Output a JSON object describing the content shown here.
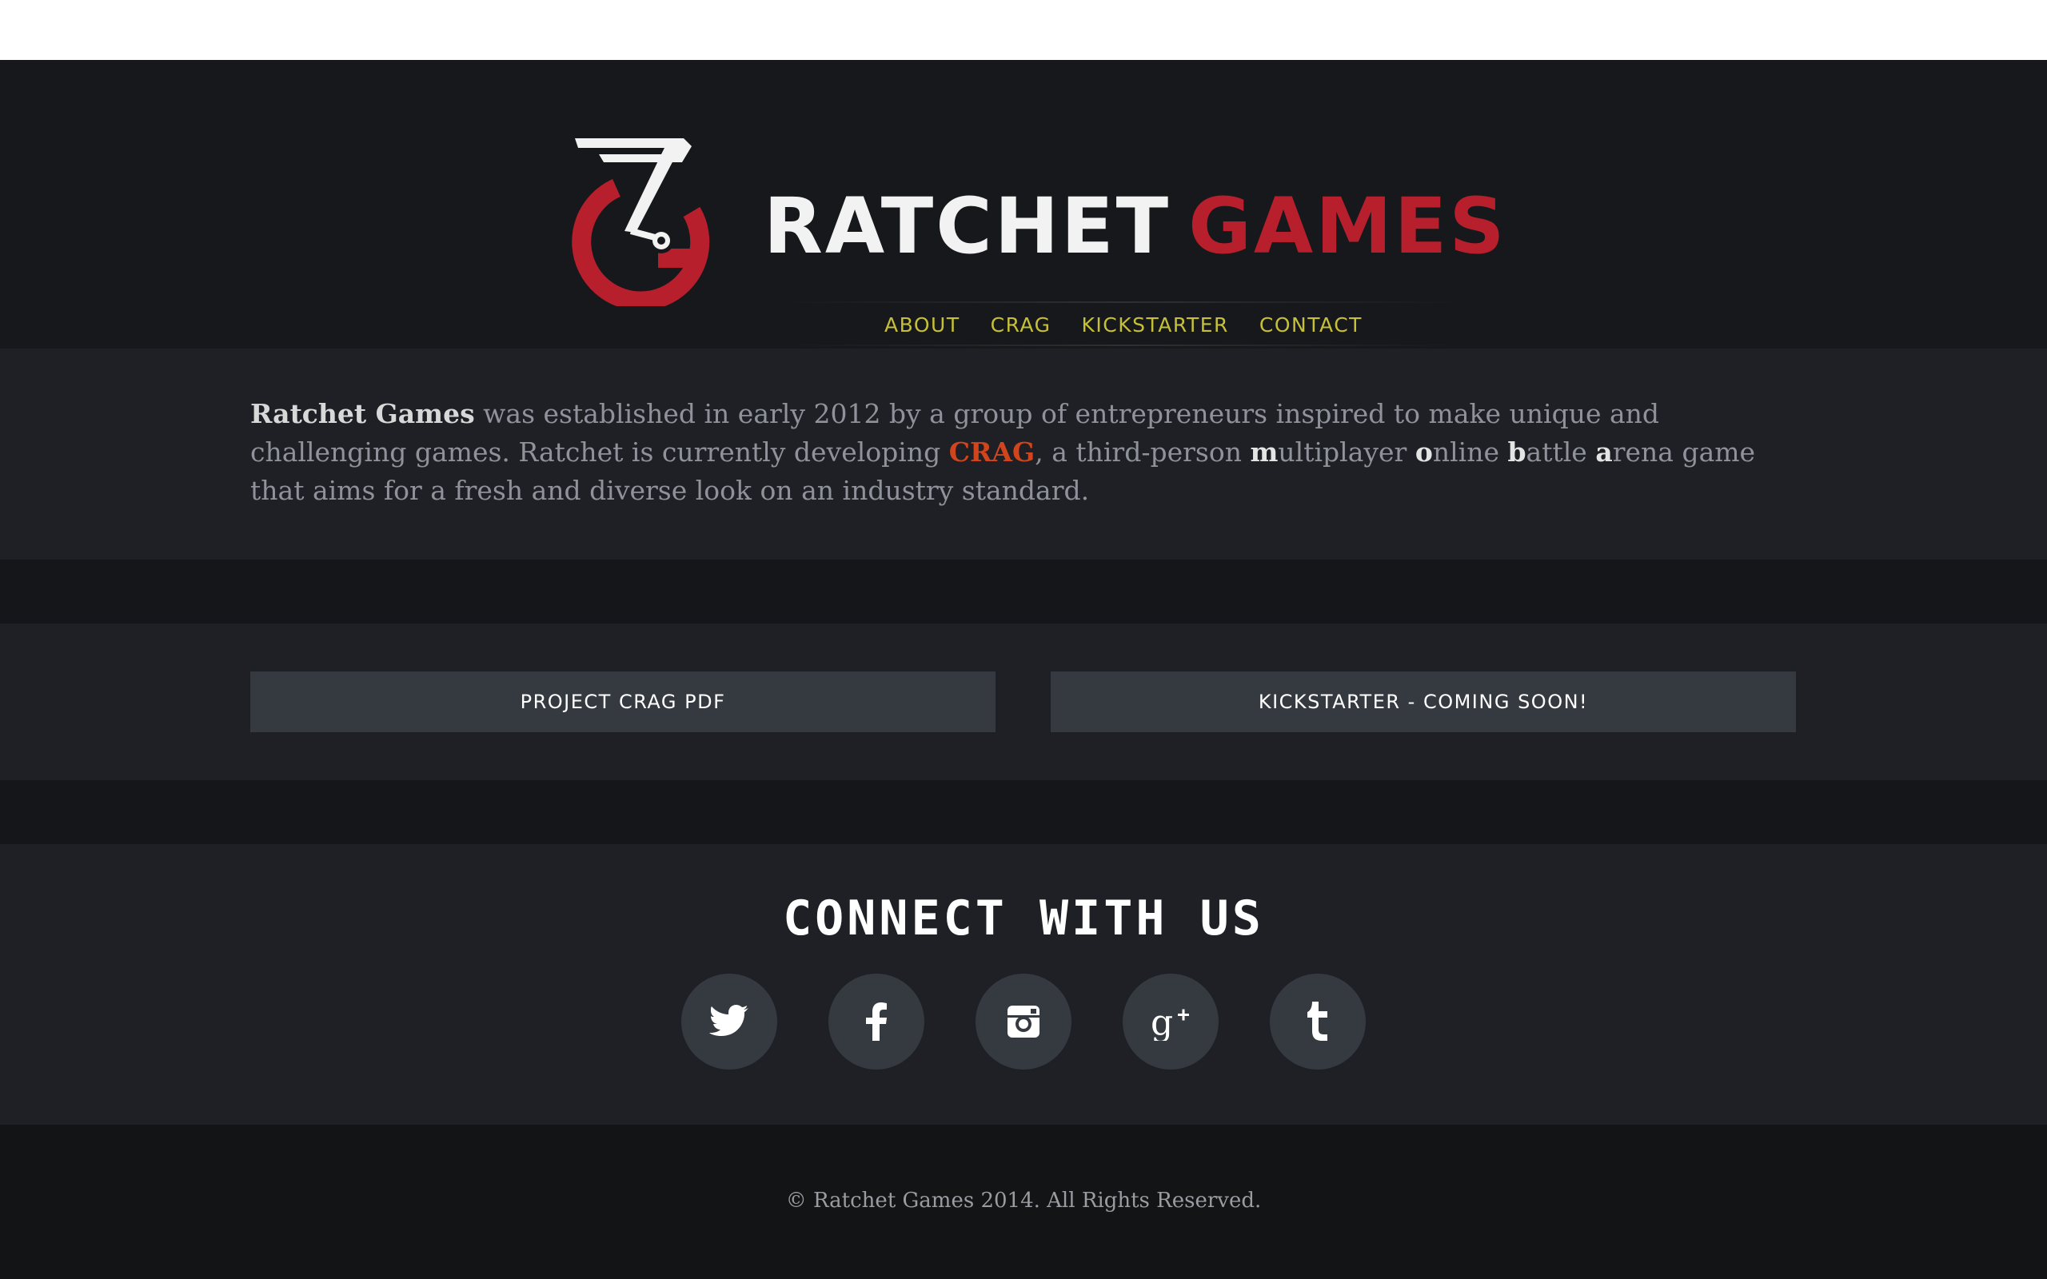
{
  "brand": {
    "name_primary": "RATCHET",
    "name_accent": "GAMES",
    "primary_color": "#f2f2f2",
    "accent_color": "#b81f2d"
  },
  "nav": {
    "items": [
      {
        "label": "ABOUT"
      },
      {
        "label": "CRAG"
      },
      {
        "label": "KICKSTARTER"
      },
      {
        "label": "CONTACT"
      }
    ],
    "color": "#c5c037"
  },
  "about": {
    "company": "Ratchet Games",
    "text_1": " was established in early 2012 by a group of entrepreneurs inspired to make unique and challenging games. Ratchet is currently developing ",
    "project": "CRAG",
    "text_2": ", a third-person ",
    "m": "m",
    "ultiplayer": "ultiplayer ",
    "o": "o",
    "nline": "nline ",
    "b": "b",
    "attle": "attle ",
    "a": "a",
    "rena": "rena game that aims for a fresh and diverse look on an industry standard."
  },
  "actions": {
    "pdf_label": "PROJECT CRAG PDF",
    "kickstarter_label": "KICKSTARTER - COMING SOON!"
  },
  "connect": {
    "heading": "CONNECT WITH US",
    "icons": [
      "twitter-icon",
      "facebook-icon",
      "instagram-icon",
      "google-plus-icon",
      "tumblr-icon"
    ]
  },
  "footer": {
    "copyright": "© Ratchet Games 2014. All Rights Reserved."
  }
}
